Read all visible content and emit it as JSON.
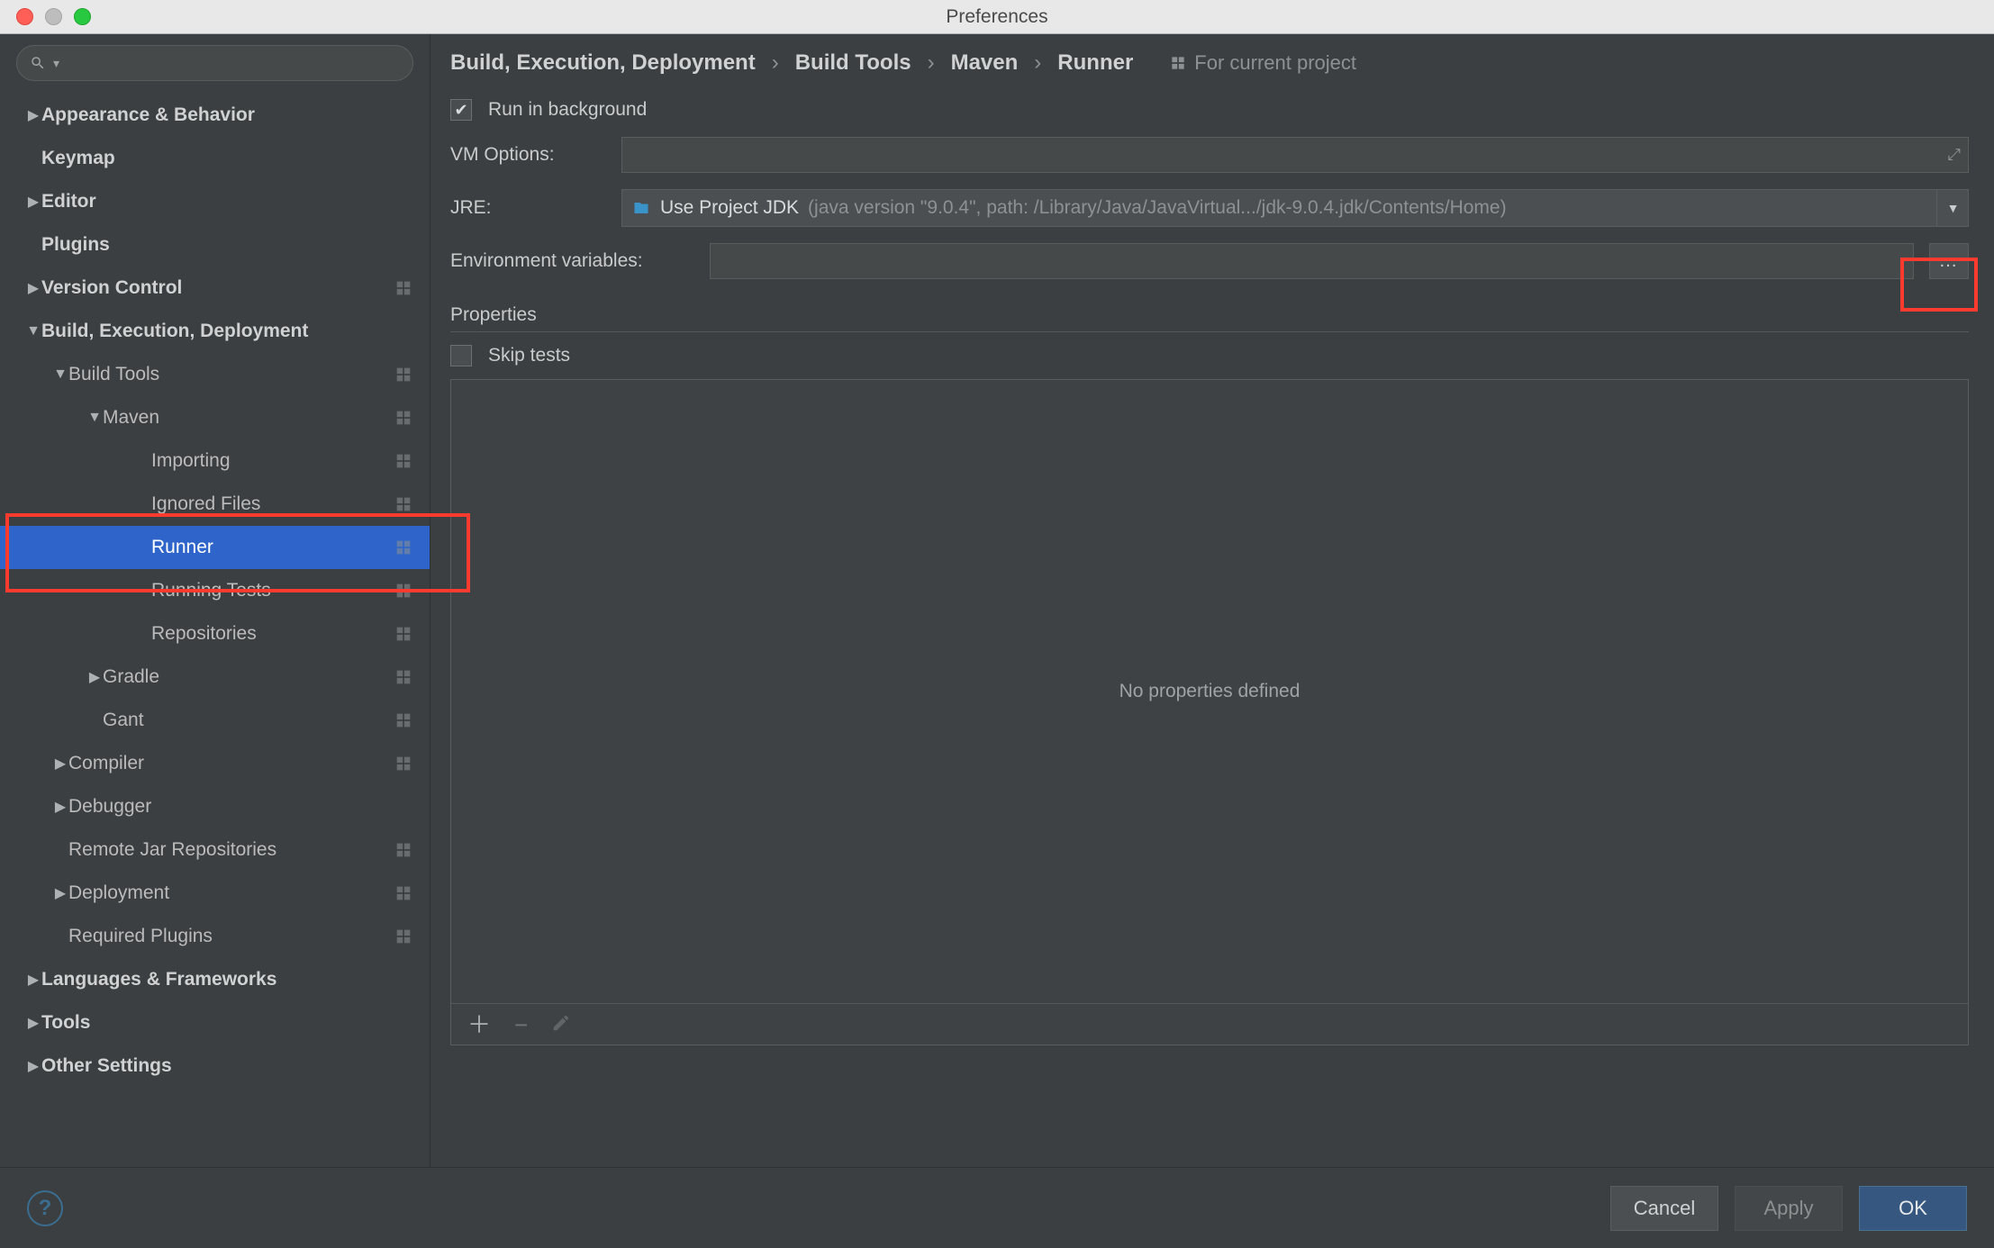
{
  "window": {
    "title": "Preferences"
  },
  "sidebar": {
    "search_placeholder": "",
    "items": [
      {
        "label": "Appearance & Behavior",
        "depth": 0,
        "arrow": "right",
        "bold": true,
        "badge": false
      },
      {
        "label": "Keymap",
        "depth": 0,
        "arrow": "",
        "bold": true,
        "badge": false
      },
      {
        "label": "Editor",
        "depth": 0,
        "arrow": "right",
        "bold": true,
        "badge": false
      },
      {
        "label": "Plugins",
        "depth": 0,
        "arrow": "",
        "bold": true,
        "badge": false
      },
      {
        "label": "Version Control",
        "depth": 0,
        "arrow": "right",
        "bold": true,
        "badge": true
      },
      {
        "label": "Build, Execution, Deployment",
        "depth": 0,
        "arrow": "down",
        "bold": true,
        "badge": false
      },
      {
        "label": "Build Tools",
        "depth": 1,
        "arrow": "down",
        "bold": false,
        "badge": true
      },
      {
        "label": "Maven",
        "depth": 2,
        "arrow": "down",
        "bold": false,
        "badge": true
      },
      {
        "label": "Importing",
        "depth": 3,
        "arrow": "",
        "bold": false,
        "badge": true
      },
      {
        "label": "Ignored Files",
        "depth": 3,
        "arrow": "",
        "bold": false,
        "badge": true
      },
      {
        "label": "Runner",
        "depth": 3,
        "arrow": "",
        "bold": false,
        "badge": true,
        "selected": true
      },
      {
        "label": "Running Tests",
        "depth": 3,
        "arrow": "",
        "bold": false,
        "badge": true
      },
      {
        "label": "Repositories",
        "depth": 3,
        "arrow": "",
        "bold": false,
        "badge": true
      },
      {
        "label": "Gradle",
        "depth": 2,
        "arrow": "right",
        "bold": false,
        "badge": true
      },
      {
        "label": "Gant",
        "depth": 2,
        "arrow": "",
        "bold": false,
        "badge": true
      },
      {
        "label": "Compiler",
        "depth": 1,
        "arrow": "right",
        "bold": false,
        "badge": true
      },
      {
        "label": "Debugger",
        "depth": 1,
        "arrow": "right",
        "bold": false,
        "badge": false
      },
      {
        "label": "Remote Jar Repositories",
        "depth": 1,
        "arrow": "",
        "bold": false,
        "badge": true
      },
      {
        "label": "Deployment",
        "depth": 1,
        "arrow": "right",
        "bold": false,
        "badge": true
      },
      {
        "label": "Required Plugins",
        "depth": 1,
        "arrow": "",
        "bold": false,
        "badge": true
      },
      {
        "label": "Languages & Frameworks",
        "depth": 0,
        "arrow": "right",
        "bold": true,
        "badge": false
      },
      {
        "label": "Tools",
        "depth": 0,
        "arrow": "right",
        "bold": true,
        "badge": false
      },
      {
        "label": "Other Settings",
        "depth": 0,
        "arrow": "right",
        "bold": true,
        "badge": false
      }
    ]
  },
  "breadcrumb": {
    "parts": [
      "Build, Execution, Deployment",
      "Build Tools",
      "Maven",
      "Runner"
    ],
    "project_hint": "For current project"
  },
  "form": {
    "run_bg_label": "Run in background",
    "run_bg_checked": true,
    "vm_options_label": "VM Options:",
    "vm_options_value": "",
    "jre_label": "JRE:",
    "jre_main": "Use Project JDK",
    "jre_detail": "(java version \"9.0.4\", path: /Library/Java/JavaVirtual.../jdk-9.0.4.jdk/Contents/Home)",
    "env_label": "Environment variables:",
    "env_value": "",
    "properties_title": "Properties",
    "skip_tests_label": "Skip tests",
    "skip_tests_checked": false,
    "no_props": "No properties defined"
  },
  "footer": {
    "cancel": "Cancel",
    "apply": "Apply",
    "ok": "OK"
  }
}
